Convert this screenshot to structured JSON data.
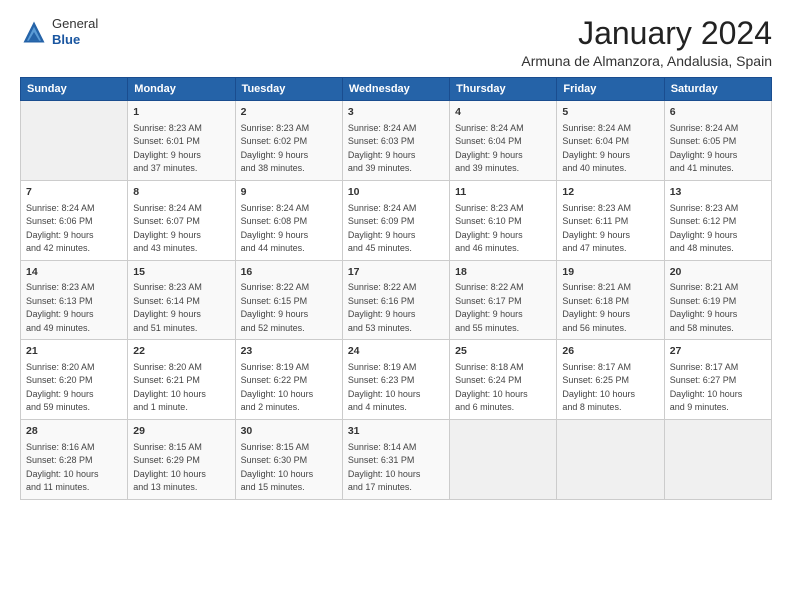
{
  "logo": {
    "general": "General",
    "blue": "Blue"
  },
  "title": "January 2024",
  "subtitle": "Armuna de Almanzora, Andalusia, Spain",
  "headers": [
    "Sunday",
    "Monday",
    "Tuesday",
    "Wednesday",
    "Thursday",
    "Friday",
    "Saturday"
  ],
  "weeks": [
    [
      {
        "day": "",
        "info": ""
      },
      {
        "day": "1",
        "info": "Sunrise: 8:23 AM\nSunset: 6:01 PM\nDaylight: 9 hours\nand 37 minutes."
      },
      {
        "day": "2",
        "info": "Sunrise: 8:23 AM\nSunset: 6:02 PM\nDaylight: 9 hours\nand 38 minutes."
      },
      {
        "day": "3",
        "info": "Sunrise: 8:24 AM\nSunset: 6:03 PM\nDaylight: 9 hours\nand 39 minutes."
      },
      {
        "day": "4",
        "info": "Sunrise: 8:24 AM\nSunset: 6:04 PM\nDaylight: 9 hours\nand 39 minutes."
      },
      {
        "day": "5",
        "info": "Sunrise: 8:24 AM\nSunset: 6:04 PM\nDaylight: 9 hours\nand 40 minutes."
      },
      {
        "day": "6",
        "info": "Sunrise: 8:24 AM\nSunset: 6:05 PM\nDaylight: 9 hours\nand 41 minutes."
      }
    ],
    [
      {
        "day": "7",
        "info": "Sunrise: 8:24 AM\nSunset: 6:06 PM\nDaylight: 9 hours\nand 42 minutes."
      },
      {
        "day": "8",
        "info": "Sunrise: 8:24 AM\nSunset: 6:07 PM\nDaylight: 9 hours\nand 43 minutes."
      },
      {
        "day": "9",
        "info": "Sunrise: 8:24 AM\nSunset: 6:08 PM\nDaylight: 9 hours\nand 44 minutes."
      },
      {
        "day": "10",
        "info": "Sunrise: 8:24 AM\nSunset: 6:09 PM\nDaylight: 9 hours\nand 45 minutes."
      },
      {
        "day": "11",
        "info": "Sunrise: 8:23 AM\nSunset: 6:10 PM\nDaylight: 9 hours\nand 46 minutes."
      },
      {
        "day": "12",
        "info": "Sunrise: 8:23 AM\nSunset: 6:11 PM\nDaylight: 9 hours\nand 47 minutes."
      },
      {
        "day": "13",
        "info": "Sunrise: 8:23 AM\nSunset: 6:12 PM\nDaylight: 9 hours\nand 48 minutes."
      }
    ],
    [
      {
        "day": "14",
        "info": "Sunrise: 8:23 AM\nSunset: 6:13 PM\nDaylight: 9 hours\nand 49 minutes."
      },
      {
        "day": "15",
        "info": "Sunrise: 8:23 AM\nSunset: 6:14 PM\nDaylight: 9 hours\nand 51 minutes."
      },
      {
        "day": "16",
        "info": "Sunrise: 8:22 AM\nSunset: 6:15 PM\nDaylight: 9 hours\nand 52 minutes."
      },
      {
        "day": "17",
        "info": "Sunrise: 8:22 AM\nSunset: 6:16 PM\nDaylight: 9 hours\nand 53 minutes."
      },
      {
        "day": "18",
        "info": "Sunrise: 8:22 AM\nSunset: 6:17 PM\nDaylight: 9 hours\nand 55 minutes."
      },
      {
        "day": "19",
        "info": "Sunrise: 8:21 AM\nSunset: 6:18 PM\nDaylight: 9 hours\nand 56 minutes."
      },
      {
        "day": "20",
        "info": "Sunrise: 8:21 AM\nSunset: 6:19 PM\nDaylight: 9 hours\nand 58 minutes."
      }
    ],
    [
      {
        "day": "21",
        "info": "Sunrise: 8:20 AM\nSunset: 6:20 PM\nDaylight: 9 hours\nand 59 minutes."
      },
      {
        "day": "22",
        "info": "Sunrise: 8:20 AM\nSunset: 6:21 PM\nDaylight: 10 hours\nand 1 minute."
      },
      {
        "day": "23",
        "info": "Sunrise: 8:19 AM\nSunset: 6:22 PM\nDaylight: 10 hours\nand 2 minutes."
      },
      {
        "day": "24",
        "info": "Sunrise: 8:19 AM\nSunset: 6:23 PM\nDaylight: 10 hours\nand 4 minutes."
      },
      {
        "day": "25",
        "info": "Sunrise: 8:18 AM\nSunset: 6:24 PM\nDaylight: 10 hours\nand 6 minutes."
      },
      {
        "day": "26",
        "info": "Sunrise: 8:17 AM\nSunset: 6:25 PM\nDaylight: 10 hours\nand 8 minutes."
      },
      {
        "day": "27",
        "info": "Sunrise: 8:17 AM\nSunset: 6:27 PM\nDaylight: 10 hours\nand 9 minutes."
      }
    ],
    [
      {
        "day": "28",
        "info": "Sunrise: 8:16 AM\nSunset: 6:28 PM\nDaylight: 10 hours\nand 11 minutes."
      },
      {
        "day": "29",
        "info": "Sunrise: 8:15 AM\nSunset: 6:29 PM\nDaylight: 10 hours\nand 13 minutes."
      },
      {
        "day": "30",
        "info": "Sunrise: 8:15 AM\nSunset: 6:30 PM\nDaylight: 10 hours\nand 15 minutes."
      },
      {
        "day": "31",
        "info": "Sunrise: 8:14 AM\nSunset: 6:31 PM\nDaylight: 10 hours\nand 17 minutes."
      },
      {
        "day": "",
        "info": ""
      },
      {
        "day": "",
        "info": ""
      },
      {
        "day": "",
        "info": ""
      }
    ]
  ]
}
